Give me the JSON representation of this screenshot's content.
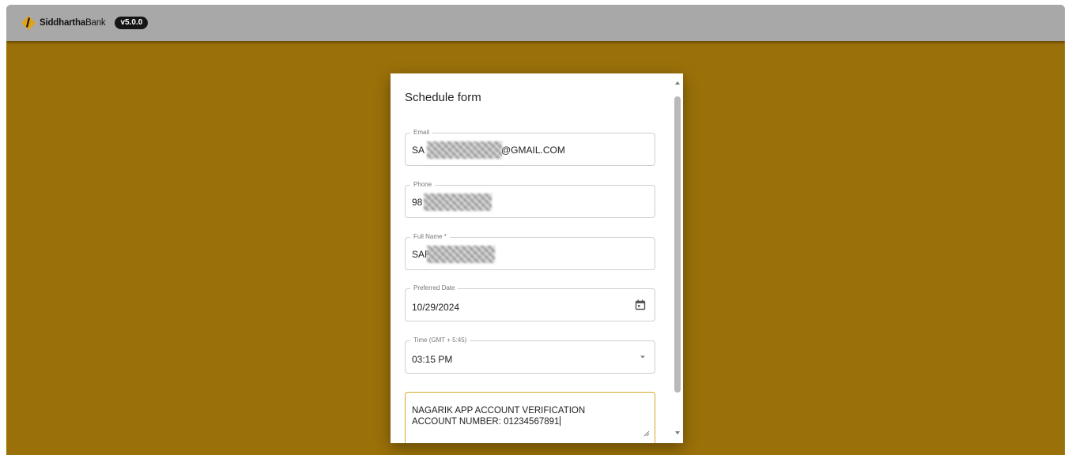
{
  "header": {
    "brand_strong": "Siddhartha",
    "brand_light": "Bank",
    "version": "v5.0.0"
  },
  "form": {
    "title": "Schedule form",
    "email": {
      "label": "Email",
      "value_prefix": "SA",
      "value_suffix": "@GMAIL.COM"
    },
    "phone": {
      "label": "Phone",
      "value_prefix": "98"
    },
    "full_name": {
      "label": "Full Name *",
      "value_prefix": "SAF"
    },
    "preferred_date": {
      "label": "Preferred Date",
      "value": "10/29/2024",
      "icon": "calendar-icon"
    },
    "time": {
      "label": "Time (GMT + 5:45)",
      "value": "03:15 PM",
      "icon": "chevron-down-icon"
    },
    "message": {
      "line1": "NAGARIK APP ACCOUNT VERIFICATION",
      "line2": "ACCOUNT NUMBER: 01234567891"
    }
  },
  "colors": {
    "page_background": "#9a7009",
    "header_background": "#a8a8a8",
    "focus_border": "#d8a830"
  }
}
